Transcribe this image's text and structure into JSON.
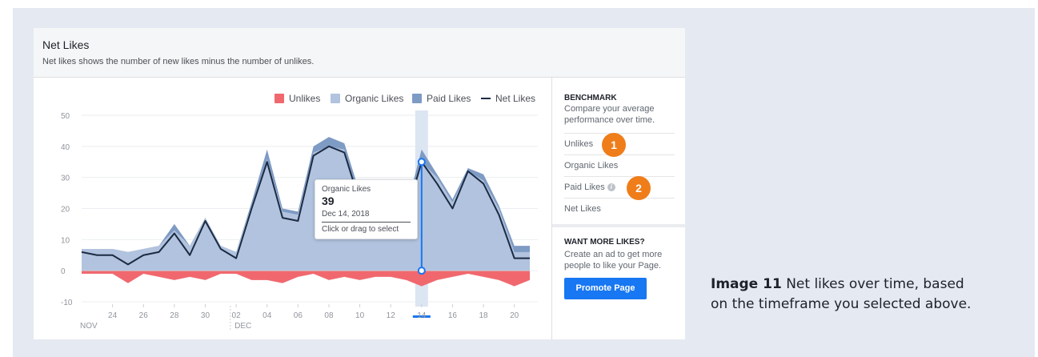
{
  "header": {
    "title": "Net Likes",
    "subtitle": "Net likes shows the number of new likes minus the number of unlikes."
  },
  "legend": {
    "unlikes": "Unlikes",
    "organic": "Organic Likes",
    "paid": "Paid Likes",
    "net": "Net Likes"
  },
  "colors": {
    "unlikes": "#f0686e",
    "organic": "#b1c3de",
    "paid": "#7e9bc4",
    "net": "#1c2b43",
    "accent": "#1877f2",
    "callout": "#ef7d1a"
  },
  "tooltip": {
    "label": "Organic Likes",
    "value": "39",
    "date": "Dec 14, 2018",
    "hint": "Click or drag to select"
  },
  "sidebar": {
    "benchmark_title": "BENCHMARK",
    "benchmark_desc": "Compare your average performance over time.",
    "metrics": [
      "Unlikes",
      "Organic Likes",
      "Paid Likes",
      "Net Likes"
    ],
    "info_icon": "i",
    "want_title": "WANT MORE LIKES?",
    "want_desc": "Create an ad to get more people to like your Page.",
    "promote_label": "Promote Page"
  },
  "callouts": [
    "1",
    "2"
  ],
  "caption": {
    "bold": "Image 11",
    "text": " Net likes over time, based on the timeframe you selected above."
  },
  "chart_data": {
    "type": "area",
    "ylim": [
      -10,
      50
    ],
    "yticks": [
      50,
      40,
      30,
      20,
      10,
      0,
      -10
    ],
    "xticks": [
      {
        "x": 24,
        "label": "24"
      },
      {
        "x": 26,
        "label": "26"
      },
      {
        "x": 28,
        "label": "28"
      },
      {
        "x": 30,
        "label": "30"
      },
      {
        "x": 32,
        "label": "02"
      },
      {
        "x": 34,
        "label": "04"
      },
      {
        "x": 36,
        "label": "06"
      },
      {
        "x": 38,
        "label": "08"
      },
      {
        "x": 40,
        "label": "10"
      },
      {
        "x": 42,
        "label": "12"
      },
      {
        "x": 44,
        "label": "14"
      },
      {
        "x": 46,
        "label": "16"
      },
      {
        "x": 48,
        "label": "18"
      },
      {
        "x": 50,
        "label": "20"
      }
    ],
    "month_labels": [
      {
        "x": 22,
        "label": "NOV"
      },
      {
        "x": 32,
        "label": "DEC"
      }
    ],
    "x": [
      22,
      23,
      24,
      25,
      26,
      27,
      28,
      29,
      30,
      31,
      32,
      33,
      34,
      35,
      36,
      37,
      38,
      39,
      40,
      41,
      42,
      43,
      44,
      45,
      46,
      47,
      48,
      49,
      50,
      51
    ],
    "series": [
      {
        "name": "Net Likes",
        "values": [
          6,
          5,
          5,
          2,
          5,
          6,
          12,
          5,
          16,
          7,
          4,
          20,
          35,
          17,
          16,
          37,
          40,
          38,
          22,
          20,
          14,
          18,
          35,
          28,
          20,
          32,
          28,
          18,
          4,
          4
        ]
      },
      {
        "name": "Organic Likes",
        "values": [
          7,
          7,
          7,
          6,
          7,
          8,
          13,
          8,
          17,
          8,
          6,
          21,
          36,
          19,
          18,
          38,
          40,
          39,
          23,
          21,
          16,
          19,
          35,
          30,
          22,
          32,
          29,
          20,
          6,
          6
        ]
      },
      {
        "name": "Paid Likes",
        "values": [
          7,
          7,
          7,
          6,
          7,
          8,
          15,
          8,
          17,
          8,
          6,
          22,
          39,
          20,
          19,
          40,
          43,
          41,
          25,
          23,
          17,
          20,
          39,
          31,
          23,
          33,
          31,
          21,
          8,
          8
        ]
      },
      {
        "name": "Unlikes",
        "values": [
          -1,
          -1,
          -1,
          -4,
          -1,
          -2,
          -3,
          -2,
          -3,
          -1,
          -1,
          -3,
          -3,
          -4,
          -2,
          -1,
          -3,
          -2,
          -3,
          -2,
          -2,
          -3,
          -5,
          -3,
          -2,
          -1,
          -2,
          -3,
          -5,
          -3
        ]
      }
    ],
    "selected_x": 44,
    "grid": true,
    "legend_position": "top-right"
  }
}
